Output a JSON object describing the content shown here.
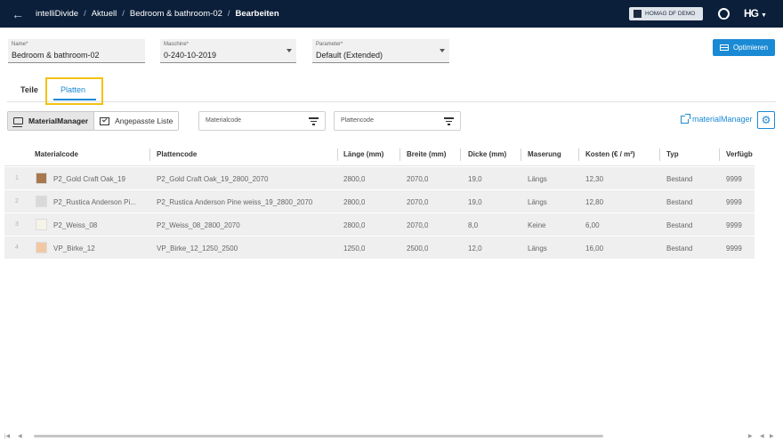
{
  "header": {
    "breadcrumbs": [
      "intelliDivide",
      "Aktuell",
      "Bedroom & bathroom-02",
      "Bearbeiten"
    ],
    "company": "HOMAG DF DEMO",
    "logo": "HG"
  },
  "form": {
    "name_label": "Name*",
    "name_value": "Bedroom & bathroom-02",
    "machine_label": "Maschine*",
    "machine_value": "0-240-10-2019",
    "param_label": "Parameter*",
    "param_value": "Default (Extended)",
    "optimize_label": "Optimieren"
  },
  "tabs": [
    {
      "label": "Teile"
    },
    {
      "label": "Platten"
    }
  ],
  "toolbar": {
    "material_manager": "MaterialManager",
    "custom_list": "Angepasste Liste",
    "filter_material_placeholder": "Materialcode",
    "filter_plate_placeholder": "Plattencode",
    "mm_link": "materialManager"
  },
  "table": {
    "columns": [
      "Materialcode",
      "Plattencode",
      "Länge (mm)",
      "Breite (mm)",
      "Dicke (mm)",
      "Maserung",
      "Kosten (€ / m²)",
      "Typ",
      "Verfügb"
    ],
    "rows": [
      {
        "n": "1",
        "material": "P2_Gold Craft Oak_19",
        "plate": "P2_Gold Craft Oak_19_2800_2070",
        "len": "2800,0",
        "wid": "2070,0",
        "thk": "19,0",
        "grain": "Längs",
        "cost": "12,30",
        "type": "Bestand",
        "avail": "9999",
        "swatch": "#a8784e"
      },
      {
        "n": "2",
        "material": "P2_Rustica Anderson Pi...",
        "plate": "P2_Rustica Anderson Pine weiss_19_2800_2070",
        "len": "2800,0",
        "wid": "2070,0",
        "thk": "19,0",
        "grain": "Längs",
        "cost": "12,80",
        "type": "Bestand",
        "avail": "9999",
        "swatch": "#d9d9d9"
      },
      {
        "n": "3",
        "material": "P2_Weiss_08",
        "plate": "P2_Weiss_08_2800_2070",
        "len": "2800,0",
        "wid": "2070,0",
        "thk": "8,0",
        "grain": "Keine",
        "cost": "6,00",
        "type": "Bestand",
        "avail": "9999",
        "swatch": "#f6f3e8"
      },
      {
        "n": "4",
        "material": "VP_Birke_12",
        "plate": "VP_Birke_12_1250_2500",
        "len": "1250,0",
        "wid": "2500,0",
        "thk": "12,0",
        "grain": "Längs",
        "cost": "16,00",
        "type": "Bestand",
        "avail": "9999",
        "swatch": "#f2c8a4"
      }
    ]
  }
}
